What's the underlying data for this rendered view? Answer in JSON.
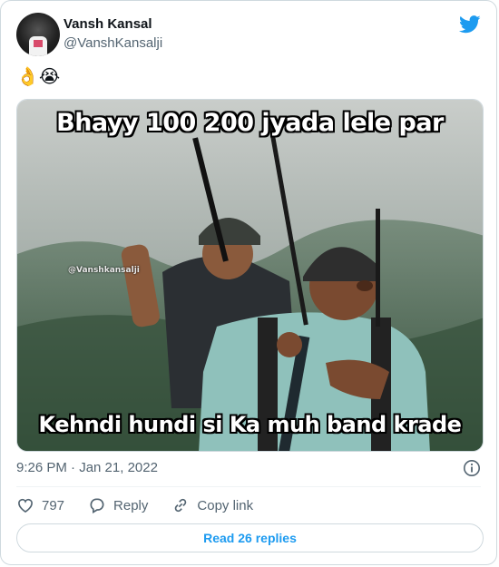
{
  "author": {
    "name": "Vansh Kansal",
    "handle": "@VanshKansalji"
  },
  "tweet": {
    "text": "👌😭",
    "timestamp": "9:26 PM · Jan 21, 2022"
  },
  "meme": {
    "top_caption": "Bhayy 100 200 jyada lele par",
    "bottom_caption": "Kehndi hundi si Ka muh band krade",
    "watermark": "@Vanshkansalji"
  },
  "actions": {
    "likes": "797",
    "reply_label": "Reply",
    "copy_label": "Copy link"
  },
  "replies_button": "Read 26 replies",
  "icons": [
    "twitter-bird-icon",
    "info-icon",
    "heart-icon",
    "reply-icon",
    "link-icon"
  ],
  "colors": {
    "accent": "#1d9bf0",
    "muted": "#536471",
    "text": "#0f1419",
    "border": "#cfd9de"
  }
}
